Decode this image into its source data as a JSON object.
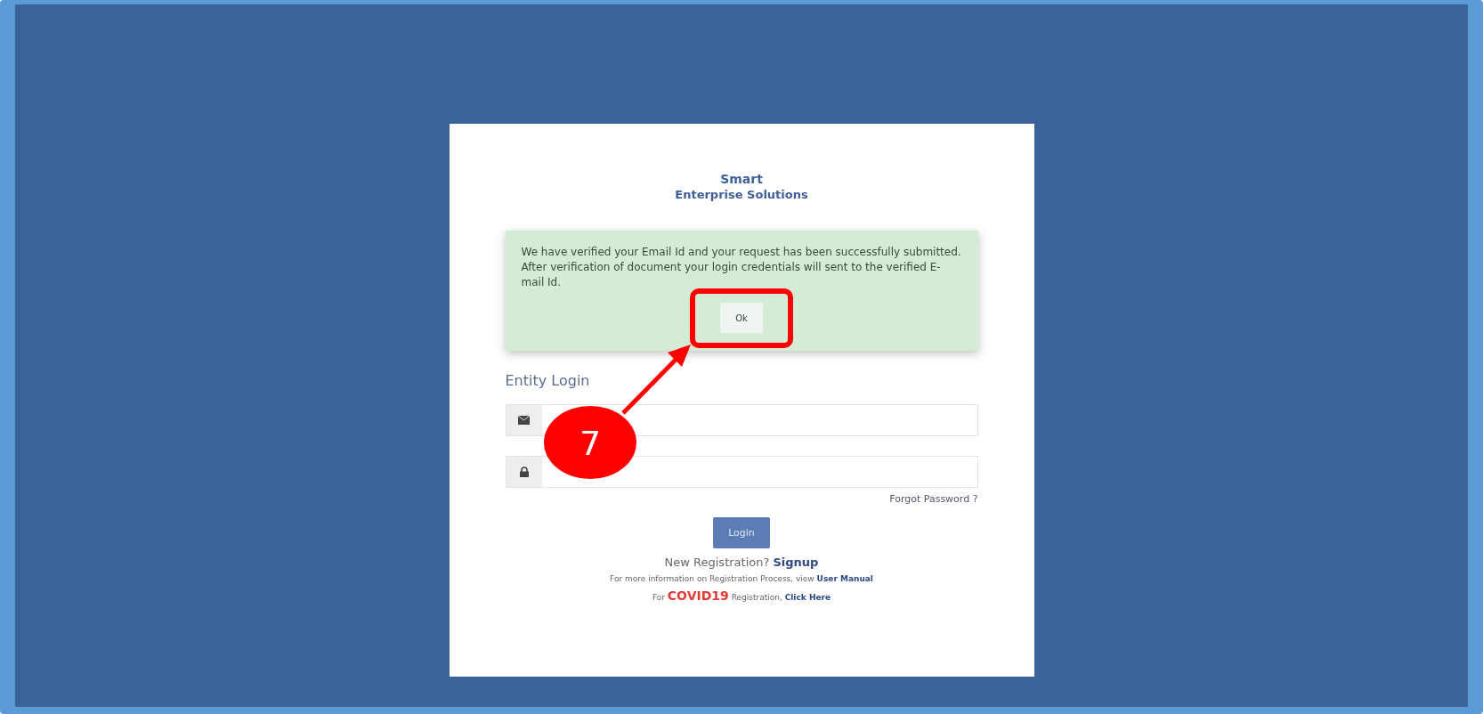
{
  "header": {
    "title": "Smart",
    "subtitle": "Enterprise Solutions"
  },
  "alert": {
    "message": "We have verified your Email Id and your request has been successfully submitted. After verification of document your login credentials will sent to the verified E-mail Id.",
    "button": "Ok",
    "highlighted": true
  },
  "login": {
    "heading": "Entity Login",
    "fields": [
      {
        "kind": "email"
      },
      {
        "kind": "password"
      }
    ],
    "forgot": "Forgot Password ?",
    "button": "Login"
  },
  "signup": {
    "text": "New Registration?",
    "link": "Signup"
  },
  "manual": {
    "text": "For more information on Registration Process, view",
    "link": "User Manual"
  },
  "covid": {
    "prefix": "For",
    "highlight": "COVID19",
    "text": "Registration,",
    "link": "Click Here"
  },
  "annotation": {
    "number": "7"
  }
}
